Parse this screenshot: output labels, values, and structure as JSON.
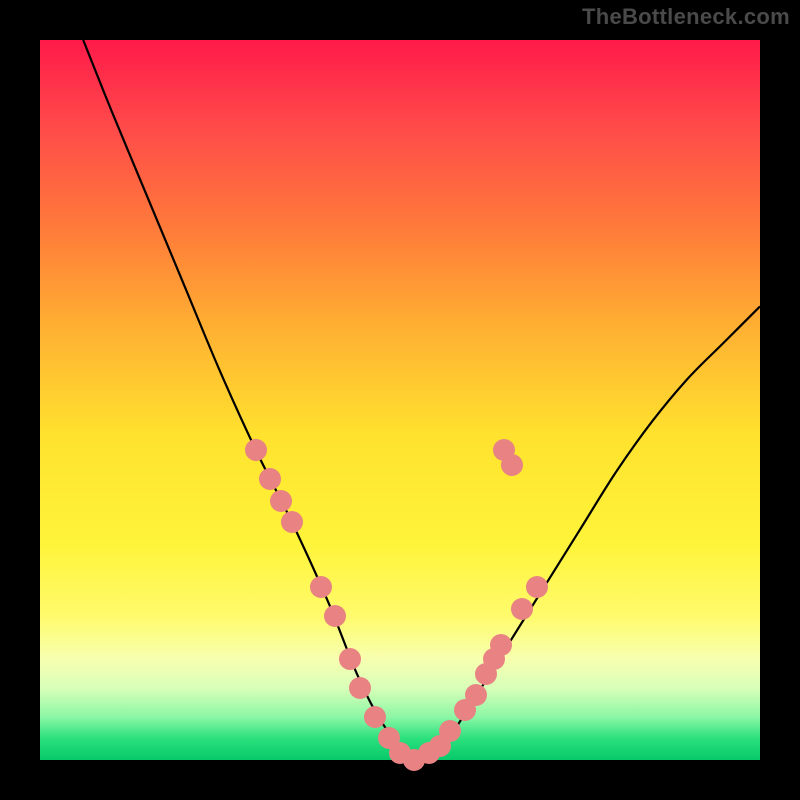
{
  "watermark": "TheBottleneck.com",
  "chart_data": {
    "type": "line",
    "title": "",
    "xlabel": "",
    "ylabel": "",
    "xlim": [
      0,
      100
    ],
    "ylim": [
      0,
      100
    ],
    "grid": false,
    "legend": false,
    "background_gradient": [
      "#ff1a4a",
      "#ffe22e",
      "#07c96a"
    ],
    "series": [
      {
        "name": "bottleneck-curve",
        "x": [
          6,
          10,
          15,
          20,
          25,
          30,
          35,
          40,
          44,
          47,
          50,
          53,
          56,
          60,
          65,
          70,
          75,
          80,
          85,
          90,
          95,
          100
        ],
        "y": [
          100,
          90,
          78,
          66,
          54,
          43,
          33,
          22,
          12,
          6,
          2,
          0,
          2,
          8,
          16,
          24,
          32,
          40,
          47,
          53,
          58,
          63
        ]
      }
    ],
    "highlight_points": [
      {
        "x": 30,
        "y": 43
      },
      {
        "x": 32,
        "y": 39
      },
      {
        "x": 33.5,
        "y": 36
      },
      {
        "x": 35,
        "y": 33
      },
      {
        "x": 39,
        "y": 24
      },
      {
        "x": 41,
        "y": 20
      },
      {
        "x": 43,
        "y": 14
      },
      {
        "x": 44.5,
        "y": 10
      },
      {
        "x": 46.5,
        "y": 6
      },
      {
        "x": 48.5,
        "y": 3
      },
      {
        "x": 50,
        "y": 1
      },
      {
        "x": 52,
        "y": 0
      },
      {
        "x": 54,
        "y": 1
      },
      {
        "x": 55.5,
        "y": 2
      },
      {
        "x": 57,
        "y": 4
      },
      {
        "x": 59,
        "y": 7
      },
      {
        "x": 60.5,
        "y": 9
      },
      {
        "x": 62,
        "y": 12
      },
      {
        "x": 63,
        "y": 14
      },
      {
        "x": 64,
        "y": 16
      },
      {
        "x": 67,
        "y": 21
      },
      {
        "x": 69,
        "y": 24
      },
      {
        "x": 64.5,
        "y": 43
      },
      {
        "x": 65.5,
        "y": 41
      }
    ]
  }
}
